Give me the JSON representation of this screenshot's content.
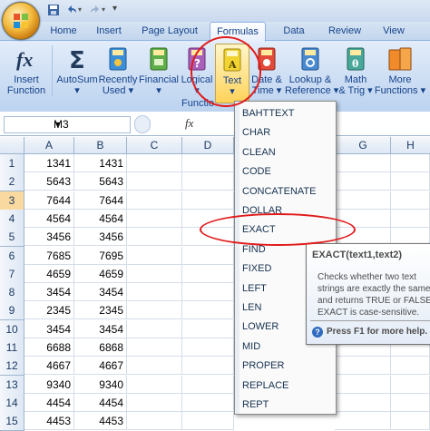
{
  "tabs": [
    "Home",
    "Insert",
    "Page Layout",
    "Formulas",
    "Data",
    "Review",
    "View"
  ],
  "active_tab": "Formulas",
  "ribbon": {
    "buttons": [
      {
        "label1": "Insert",
        "label2": "Function",
        "icon": "fx-icon"
      },
      {
        "label1": "AutoSum",
        "label2": "▾",
        "icon": "sigma-icon"
      },
      {
        "label1": "Recently",
        "label2": "Used ▾",
        "icon": "book-icon"
      },
      {
        "label1": "Financial",
        "label2": "▾",
        "icon": "book-icon"
      },
      {
        "label1": "Logical",
        "label2": "▾",
        "icon": "book-icon"
      },
      {
        "label1": "Text",
        "label2": "▾",
        "icon": "book-icon"
      },
      {
        "label1": "Date &",
        "label2": "Time ▾",
        "icon": "book-icon"
      },
      {
        "label1": "Lookup &",
        "label2": "Reference ▾",
        "icon": "book-icon"
      },
      {
        "label1": "Math",
        "label2": "& Trig ▾",
        "icon": "book-icon"
      },
      {
        "label1": "More",
        "label2": "Functions ▾",
        "icon": "book-icon"
      }
    ],
    "group_label": "Functio"
  },
  "formula_bar": {
    "name_box": "M3",
    "fx": "fx"
  },
  "columns": [
    "A",
    "B",
    "C",
    "D",
    "E",
    "F",
    "G",
    "H"
  ],
  "rows": [
    {
      "n": "1",
      "a": "1341",
      "b": "1431"
    },
    {
      "n": "2",
      "a": "5643",
      "b": "5643"
    },
    {
      "n": "3",
      "a": "7644",
      "b": "7644"
    },
    {
      "n": "4",
      "a": "4564",
      "b": "4564"
    },
    {
      "n": "5",
      "a": "3456",
      "b": "3456"
    },
    {
      "n": "6",
      "a": "7685",
      "b": "7695"
    },
    {
      "n": "7",
      "a": "4659",
      "b": "4659"
    },
    {
      "n": "8",
      "a": "3454",
      "b": "3454"
    },
    {
      "n": "9",
      "a": "2345",
      "b": "2345"
    },
    {
      "n": "10",
      "a": "3454",
      "b": "3454"
    },
    {
      "n": "11",
      "a": "6688",
      "b": "6868"
    },
    {
      "n": "12",
      "a": "4667",
      "b": "4667"
    },
    {
      "n": "13",
      "a": "9340",
      "b": "9340"
    },
    {
      "n": "14",
      "a": "4454",
      "b": "4454"
    },
    {
      "n": "15",
      "a": "4453",
      "b": "4453"
    }
  ],
  "selected_row": "3",
  "menu_items": [
    "BAHTTEXT",
    "CHAR",
    "CLEAN",
    "CODE",
    "CONCATENATE",
    "DOLLAR",
    "EXACT",
    "FIND",
    "FIXED",
    "LEFT",
    "LEN",
    "LOWER",
    "MID",
    "PROPER",
    "REPLACE",
    "REPT"
  ],
  "tooltip": {
    "title": "EXACT(text1,text2)",
    "body": "Checks whether two text strings are exactly the same, and returns TRUE or FALSE. EXACT is case-sensitive.",
    "help": "Press F1 for more help."
  },
  "colors": {
    "annotation": "#e11a1a",
    "ribbon": "#c7daf2",
    "selected_row": "#f9d99f"
  }
}
